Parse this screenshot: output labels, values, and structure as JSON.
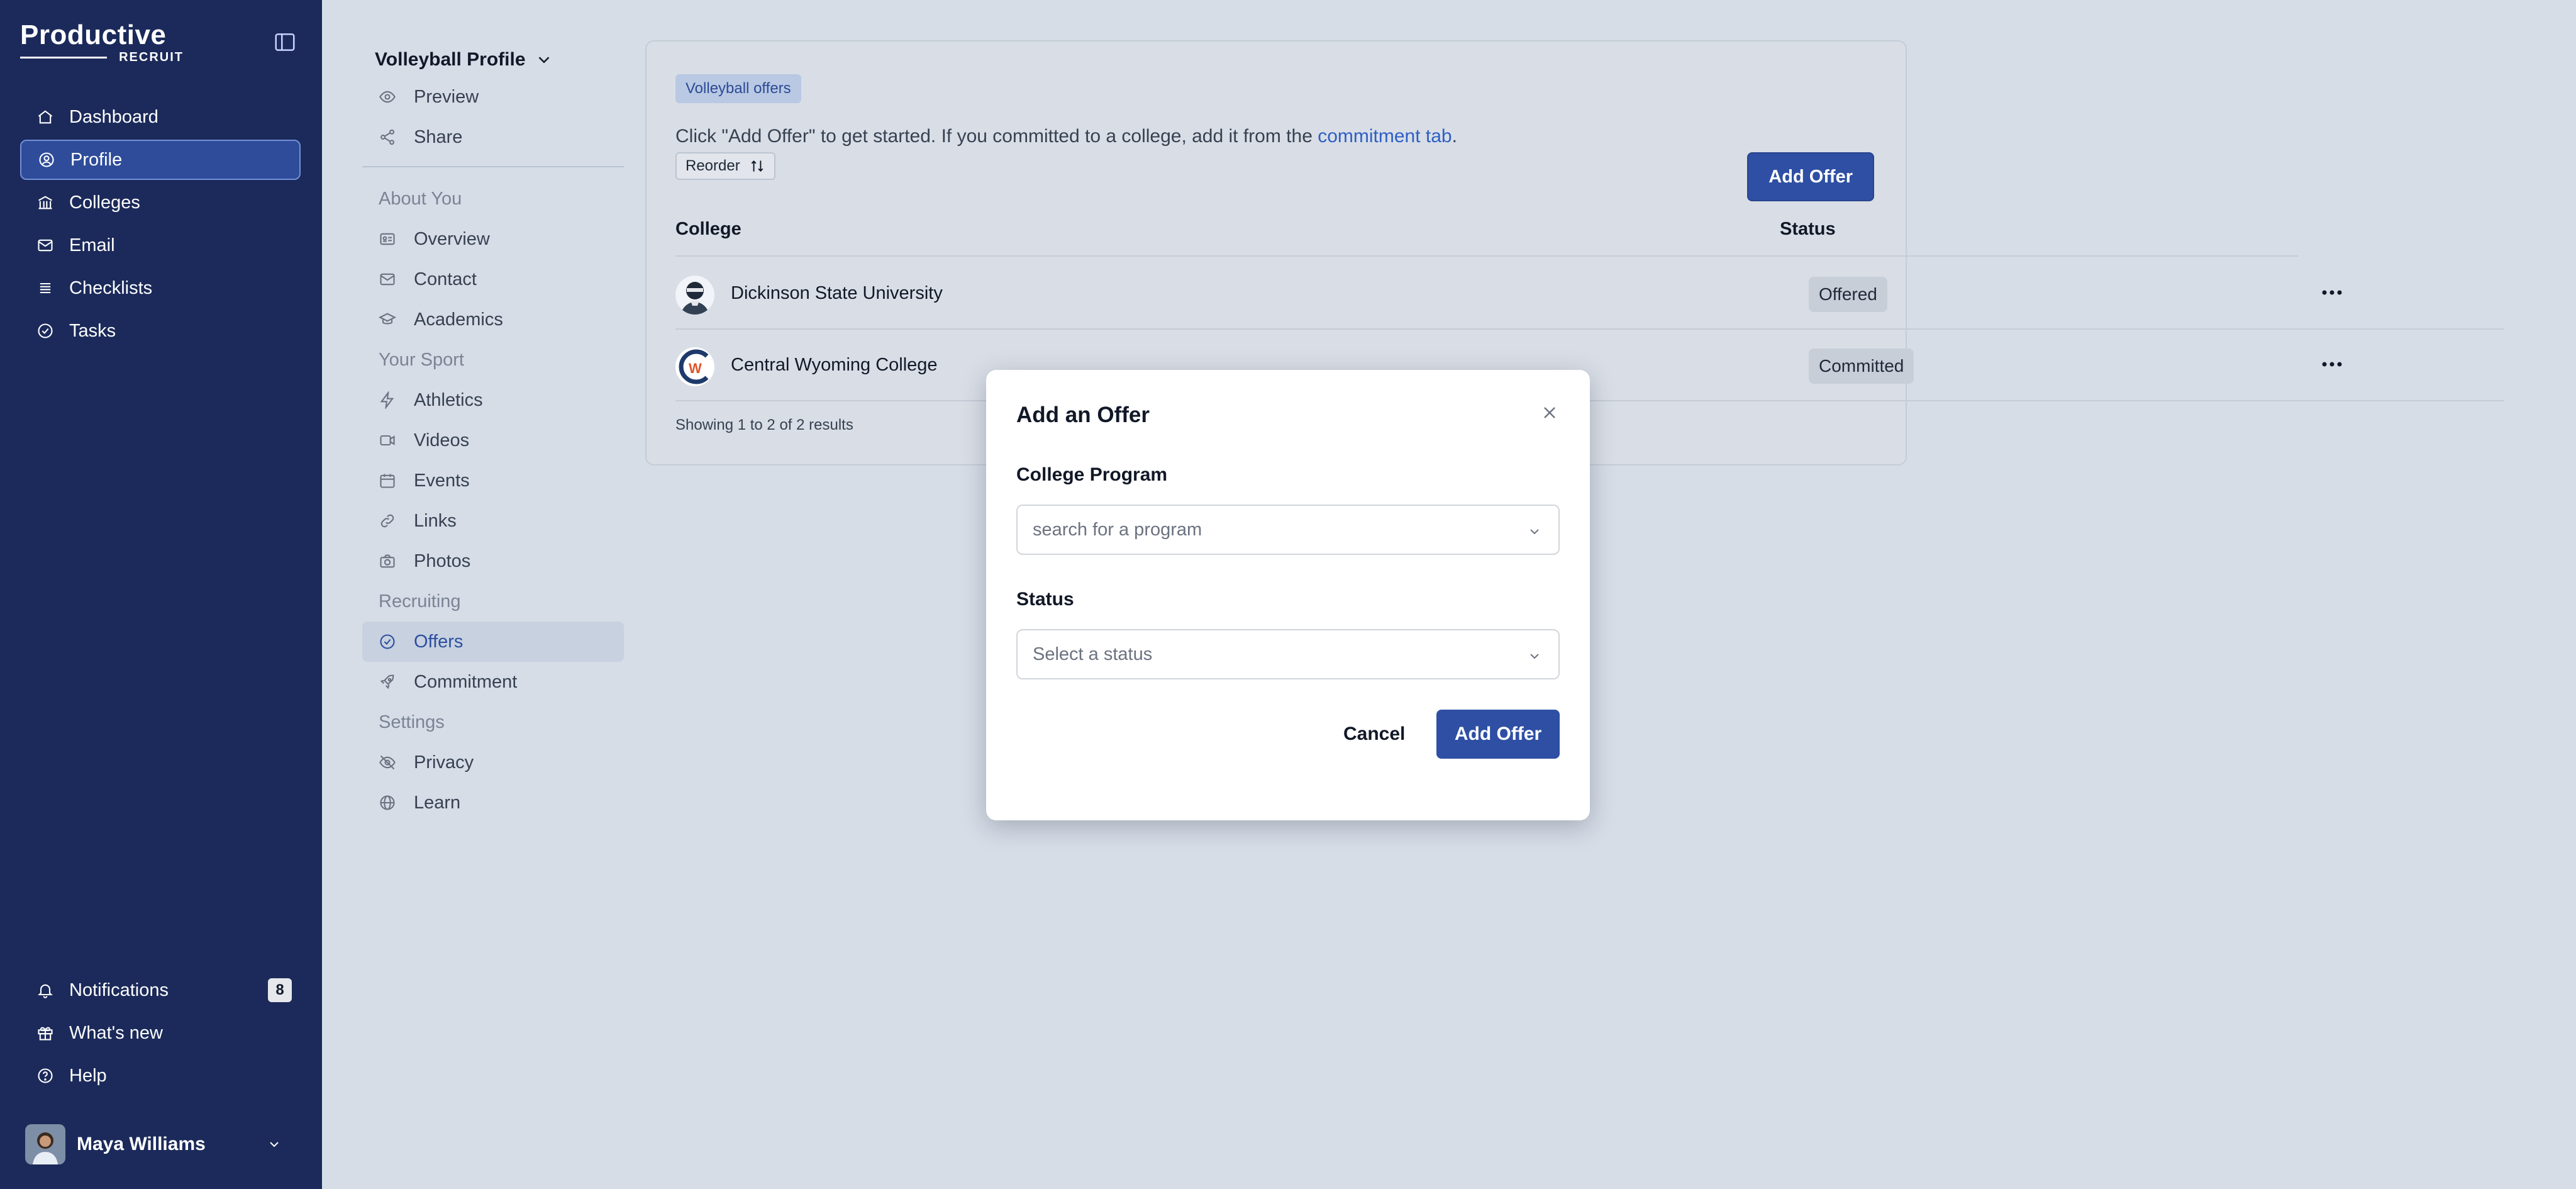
{
  "app": {
    "brand": "Productive",
    "brand_sub": "RECRUIT",
    "nav": [
      {
        "label": "Dashboard",
        "icon": "home-icon"
      },
      {
        "label": "Profile",
        "icon": "user-circle-icon",
        "active": true
      },
      {
        "label": "Colleges",
        "icon": "building-icon"
      },
      {
        "label": "Email",
        "icon": "mail-icon"
      },
      {
        "label": "Checklists",
        "icon": "list-icon"
      },
      {
        "label": "Tasks",
        "icon": "check-circle-icon"
      }
    ],
    "bottom_nav": [
      {
        "label": "Notifications",
        "icon": "bell-icon",
        "badge": "8"
      },
      {
        "label": "What's new",
        "icon": "gift-icon"
      },
      {
        "label": "Help",
        "icon": "help-circle-icon"
      }
    ],
    "user": {
      "name": "Maya Williams"
    },
    "accent": "#2e4fa3",
    "sidebar_bg": "#1b2a5a"
  },
  "profile_menu": {
    "switcher": "Volleyball Profile",
    "top": [
      {
        "label": "Preview",
        "icon": "eye-icon"
      },
      {
        "label": "Share",
        "icon": "share-icon"
      }
    ],
    "sections": [
      {
        "title": "About You",
        "items": [
          {
            "label": "Overview",
            "icon": "id-card-icon"
          },
          {
            "label": "Contact",
            "icon": "mail-icon"
          },
          {
            "label": "Academics",
            "icon": "graduation-cap-icon"
          }
        ]
      },
      {
        "title": "Your Sport",
        "items": [
          {
            "label": "Athletics",
            "icon": "bolt-icon"
          },
          {
            "label": "Videos",
            "icon": "video-icon"
          },
          {
            "label": "Events",
            "icon": "calendar-icon"
          },
          {
            "label": "Links",
            "icon": "link-icon"
          },
          {
            "label": "Photos",
            "icon": "camera-icon"
          }
        ]
      },
      {
        "title": "Recruiting",
        "items": [
          {
            "label": "Offers",
            "icon": "check-circle-icon",
            "active": true
          },
          {
            "label": "Commitment",
            "icon": "rocket-icon"
          }
        ]
      },
      {
        "title": "Settings",
        "items": [
          {
            "label": "Privacy",
            "icon": "eye-off-icon"
          },
          {
            "label": "Learn",
            "icon": "globe-icon"
          }
        ]
      }
    ]
  },
  "offers": {
    "tag": "Volleyball offers",
    "intro_text": "Click \"Add Offer\" to get started. If you committed to a college, add it from the ",
    "intro_link": "commitment tab",
    "intro_end": ".",
    "reorder_label": "Reorder",
    "add_offer_label": "Add Offer",
    "columns": [
      "College",
      "Status"
    ],
    "rows": [
      {
        "college": "Dickinson State University",
        "status": "Offered"
      },
      {
        "college": "Central Wyoming College",
        "status": "Committed"
      }
    ],
    "results_text": "Showing 1 to 2 of 2 results"
  },
  "modal": {
    "title": "Add an Offer",
    "program_label": "College Program",
    "program_placeholder": "search for a program",
    "status_label": "Status",
    "status_placeholder": "Select a status",
    "cancel_label": "Cancel",
    "submit_label": "Add Offer"
  }
}
